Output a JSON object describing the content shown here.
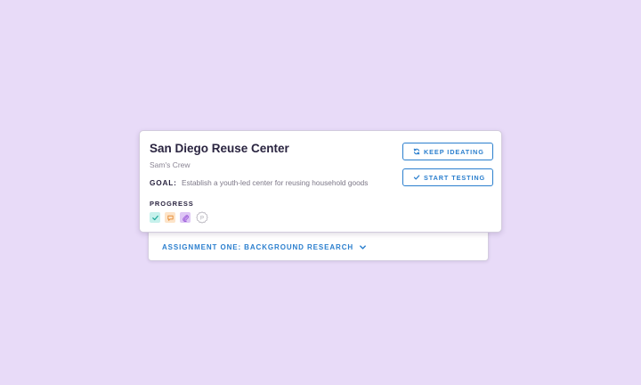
{
  "assignment": {
    "label": "ASSIGNMENT ONE: BACKGROUND RESEARCH",
    "icon": "chevron-down-icon"
  },
  "project": {
    "title": "San Diego Reuse Center",
    "team": "Sam's Crew",
    "goal_label": "GOAL:",
    "goal_text": "Establish a youth-led center for reusing household goods"
  },
  "progress": {
    "label": "PROGRESS",
    "stages": [
      {
        "icon": "check-icon",
        "color": "#1fa99b",
        "bg": "#c7f1ec",
        "state": "complete"
      },
      {
        "icon": "chat-bubble-icon",
        "color": "#e8923f",
        "bg": "#fde4c9",
        "state": "complete"
      },
      {
        "icon": "paperclip-icon",
        "color": "#9b59d9",
        "bg": "#dec7f5",
        "state": "complete"
      },
      {
        "icon": "badge-p-icon",
        "letter": "P",
        "color": "#a9a6b0",
        "state": "pending"
      }
    ]
  },
  "actions": {
    "keep_ideating": {
      "label": "KEEP IDEATING",
      "icon": "refresh-icon"
    },
    "start_testing": {
      "label": "START TESTING",
      "icon": "check-icon"
    }
  },
  "colors": {
    "background": "#e8dbf8",
    "accent": "#2b7fce",
    "title": "#2a2440",
    "muted": "#8a8594"
  }
}
